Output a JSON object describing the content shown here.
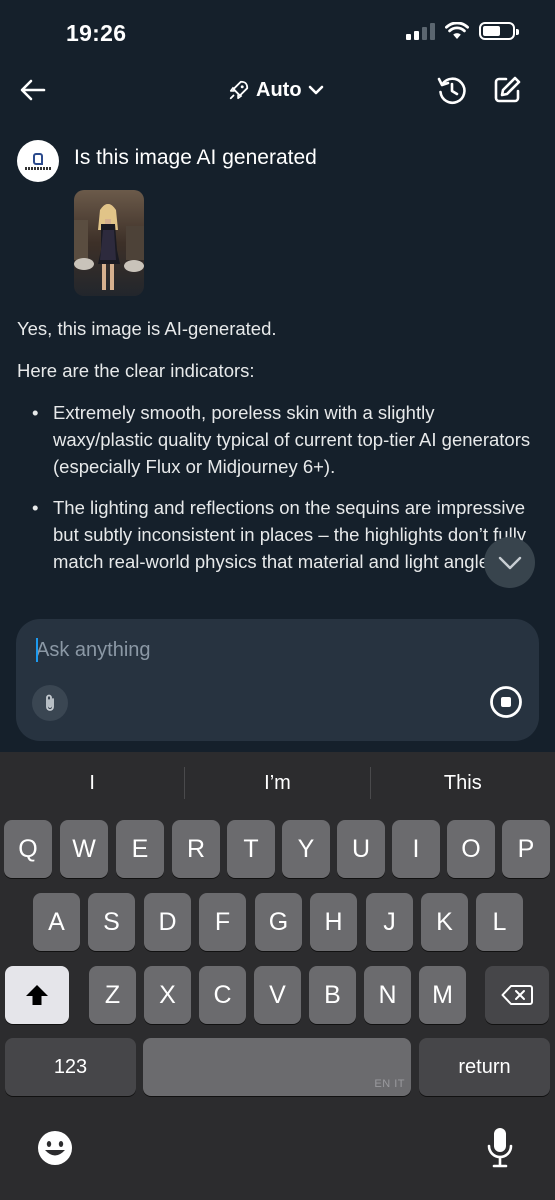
{
  "status": {
    "time": "19:26"
  },
  "nav": {
    "model": "Auto",
    "icons": [
      "back-arrow-icon",
      "rocket-icon",
      "chevron-down-icon",
      "history-icon",
      "compose-icon"
    ]
  },
  "conversation": {
    "user_message": "Is this image AI generated",
    "reply_intro": "Yes, this image is AI-generated.",
    "reply_lead": "Here are the clear indicators:",
    "bullets": [
      "Extremely smooth, poreless skin with a slightly waxy/plastic quality typical of current top-tier AI generators (especially Flux or Midjourney 6+).",
      "The lighting and reflections on the sequins are impressive but subtly inconsistent in places – the highlights don’t fully match real-world physics that material and light angle."
    ],
    "bullet_symbol": "•"
  },
  "composer": {
    "placeholder": "Ask anything"
  },
  "keyboard": {
    "suggestions": [
      "I",
      "I’m",
      "This"
    ],
    "row1": [
      "Q",
      "W",
      "E",
      "R",
      "T",
      "Y",
      "U",
      "I",
      "O",
      "P"
    ],
    "row2": [
      "A",
      "S",
      "D",
      "F",
      "G",
      "H",
      "J",
      "K",
      "L"
    ],
    "row3": [
      "Z",
      "X",
      "C",
      "V",
      "B",
      "N",
      "M"
    ],
    "numbers_label": "123",
    "return_label": "return",
    "space_lang": "EN IT"
  },
  "colors": {
    "background": "#15202b",
    "composer": "#273340",
    "accent": "#1d9bf0",
    "keyboard": "#2c2c2e"
  }
}
